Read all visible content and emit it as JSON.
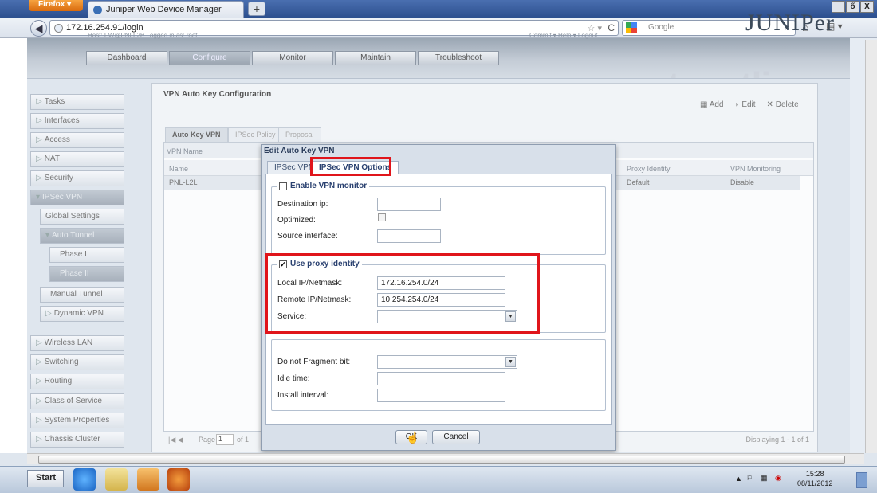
{
  "browser": {
    "app_button": "Firefox",
    "tab_title": "Juniper Web Device Manager",
    "new_tab": "+",
    "url": "172.16.254.91/login",
    "search_placeholder": "Google",
    "win_minimize": "_",
    "win_restore": "ő",
    "win_close": "X"
  },
  "header": {
    "tabs": [
      "Dashboard",
      "Configure",
      "Monitor",
      "Maintain",
      "Troubleshoot"
    ],
    "active_tab": "Configure",
    "subnav": "Host: FW@PNLL2B    Logged in as: root",
    "subnav_right": "Commit ▾   Help ▾   Logout",
    "logo": "JUNIPer",
    "watermark": "petenetlive"
  },
  "sidebar": {
    "items": [
      {
        "label": "Tasks"
      },
      {
        "label": "Interfaces"
      },
      {
        "label": "Access"
      },
      {
        "label": "NAT"
      },
      {
        "label": "Security"
      },
      {
        "label": "IPSec VPN"
      },
      {
        "label": "Global Settings"
      },
      {
        "label": "Auto Tunnel"
      },
      {
        "label": "Phase I"
      },
      {
        "label": "Phase II"
      },
      {
        "label": "Manual Tunnel"
      },
      {
        "label": "Dynamic VPN"
      },
      {
        "label": "Wireless LAN"
      },
      {
        "label": "Switching"
      },
      {
        "label": "Routing"
      },
      {
        "label": "Class of Service"
      },
      {
        "label": "System Properties"
      },
      {
        "label": "Chassis Cluster"
      }
    ]
  },
  "page": {
    "title": "VPN Auto Key Configuration",
    "actions": {
      "add": "Add",
      "edit": "Edit",
      "delete": "Delete"
    },
    "tabs": [
      "Auto Key VPN",
      "IPSec Policy",
      "Proposal"
    ],
    "filter_label": "VPN Name",
    "columns": {
      "name": "Name",
      "proxy_identity": "Proxy Identity",
      "vpn_monitoring": "VPN Monitoring"
    },
    "row": {
      "name": "PNL-L2L",
      "proxy_identity": "Default",
      "vpn_monitoring": "Disable"
    },
    "pager_page": "Page",
    "pager_value": "1",
    "pager_of": "of 1",
    "displaying": "Displaying 1 - 1 of 1"
  },
  "dialog": {
    "title": "Edit Auto Key VPN",
    "tabs": [
      "IPSec VPN",
      "IPSec VPN Options"
    ],
    "vpn_monitor": {
      "legend": "Enable VPN monitor",
      "checked": false,
      "destination_ip_label": "Destination ip:",
      "destination_ip": "",
      "optimized_label": "Optimized:",
      "source_interface_label": "Source interface:",
      "source_interface": ""
    },
    "proxy": {
      "legend": "Use proxy identity",
      "checked": true,
      "local_label": "Local IP/Netmask:",
      "local_value": "172.16.254.0/24",
      "remote_label": "Remote IP/Netmask:",
      "remote_value": "10.254.254.0/24",
      "service_label": "Service:",
      "service_value": ""
    },
    "misc": {
      "df_label": "Do not Fragment bit:",
      "df_value": "",
      "idle_label": "Idle time:",
      "idle_value": "",
      "install_label": "Install interval:",
      "install_value": ""
    },
    "ok": "OK",
    "cancel": "Cancel"
  },
  "taskbar": {
    "start": "Start",
    "time": "15:28",
    "date": "08/11/2012"
  },
  "colors": {
    "highlight_red": "#e0151b",
    "dialog_accent": "#2a4170"
  }
}
